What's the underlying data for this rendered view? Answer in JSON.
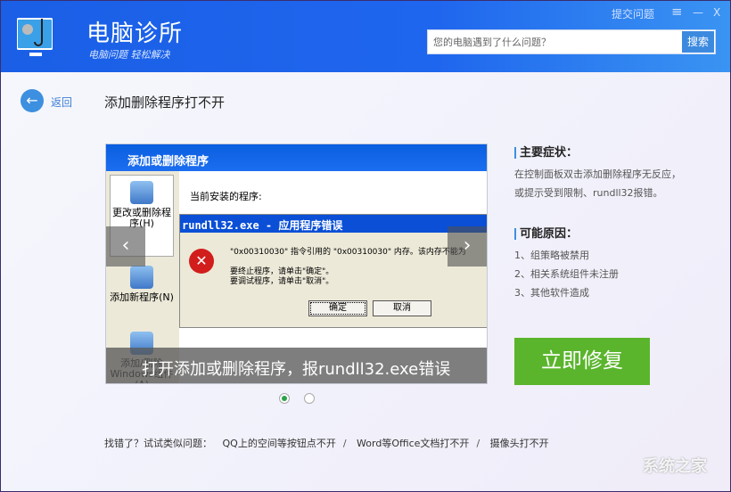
{
  "header": {
    "title": "电脑诊所",
    "subtitle": "电脑问题 轻松解决",
    "submit_issue": "提交问题",
    "menu_icon": "≡",
    "minimize_icon": "—",
    "close_icon": "X",
    "search": {
      "placeholder": "您的电脑遇到了什么问题？",
      "button": "搜索"
    }
  },
  "nav": {
    "back_label": "返回",
    "page_title": "添加删除程序打不开"
  },
  "slide": {
    "caption": "打开添加或删除程序，报rundll32.exe错误",
    "window_title": "添加或删除程序",
    "side_items": [
      "更改或删除程序(H)",
      "添加新程序(N)",
      "添加/删除Windows组件(A)"
    ],
    "installed_label": "当前安装的程序:",
    "dialog_title": "rundll32.exe - 应用程序错误",
    "dialog_message": "\"0x00310030\" 指令引用的 \"0x00310030\" 内存。该内存不能为",
    "dialog_line1": "要终止程序，请单击\"确定\"。",
    "dialog_line2": "要调试程序，请单击\"取消\"。",
    "ok": "确定",
    "cancel": "取消",
    "prev": "‹",
    "next": "›",
    "total": 2,
    "active": 1
  },
  "info": {
    "symptoms_title": "主要症状：",
    "symptoms_text": "在控制面板双击添加删除程序无反应，或提示受到限制、rundll32报错。",
    "causes_title": "可能原因：",
    "causes": [
      "1、组策略被禁用",
      "2、相关系统组件未注册",
      "3、其他软件造成"
    ],
    "fix_button": "立即修复",
    "fix_color": "#5ab52c"
  },
  "related": {
    "label": "找错了？试试类似问题：",
    "items": [
      "QQ上的空间等按钮点不开",
      "Word等Office文档打不开",
      "摄像头打不开"
    ],
    "separator": "/"
  },
  "watermark": "系统之家"
}
